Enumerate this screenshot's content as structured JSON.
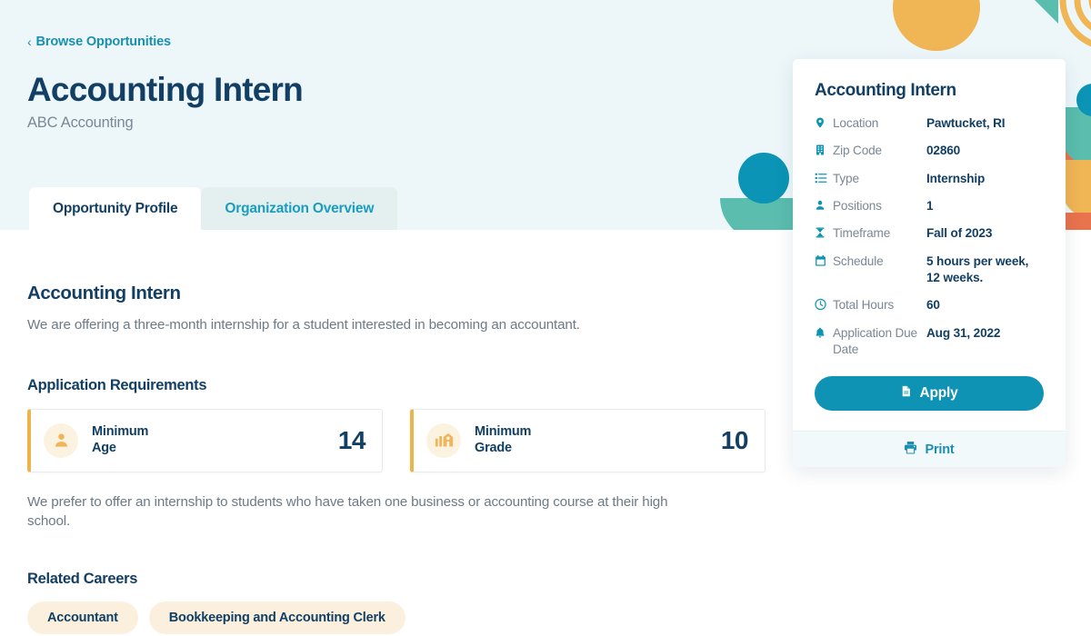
{
  "breadcrumb": {
    "chevron": "‹",
    "label": "Browse Opportunities"
  },
  "header": {
    "title": "Accounting Intern",
    "organization": "ABC Accounting"
  },
  "tabs": [
    {
      "label": "Opportunity Profile",
      "active": true
    },
    {
      "label": "Organization Overview",
      "active": false
    }
  ],
  "main": {
    "heading": "Accounting Intern",
    "description": "We are offering a three-month internship for a student interested in becoming an accountant.",
    "requirements_heading": "Application Requirements",
    "requirements": [
      {
        "icon": "person-icon",
        "label_line1": "Minimum",
        "label_line2": "Age",
        "value": "14"
      },
      {
        "icon": "school-icon",
        "label_line1": "Minimum",
        "label_line2": "Grade",
        "value": "10"
      }
    ],
    "requirements_note": "We prefer to offer an internship to students who have taken one business or accounting course at their high school.",
    "related_careers_heading": "Related Careers",
    "related_careers": [
      "Accountant",
      "Bookkeeping and Accounting Clerk"
    ]
  },
  "side_card": {
    "title": "Accounting Intern",
    "details": [
      {
        "icon": "map-pin-icon",
        "label": "Location",
        "value": "Pawtucket, RI"
      },
      {
        "icon": "building-icon",
        "label": "Zip Code",
        "value": "02860"
      },
      {
        "icon": "list-icon",
        "label": "Type",
        "value": "Internship"
      },
      {
        "icon": "person-icon",
        "label": "Positions",
        "value": "1"
      },
      {
        "icon": "hourglass-icon",
        "label": "Timeframe",
        "value": "Fall of 2023"
      },
      {
        "icon": "calendar-icon",
        "label": "Schedule",
        "value": "5 hours per week, 12 weeks."
      },
      {
        "icon": "clock-icon",
        "label": "Total Hours",
        "value": "60"
      },
      {
        "icon": "bell-icon",
        "label": "Application Due Date",
        "value": "Aug 31, 2022"
      }
    ],
    "apply_label": "Apply",
    "print_label": "Print"
  },
  "colors": {
    "hero_background": "#edf7fa",
    "navy": "#123f63",
    "teal_link": "#1b8fb0",
    "apply_button": "#0e93b4",
    "accent_gold": "#eab64c",
    "tag_background": "#fbf0de",
    "deco_orange": "#f0b554",
    "deco_teal": "#5abdae",
    "deco_blue": "#0b94b5",
    "deco_coral": "#e8734d"
  }
}
